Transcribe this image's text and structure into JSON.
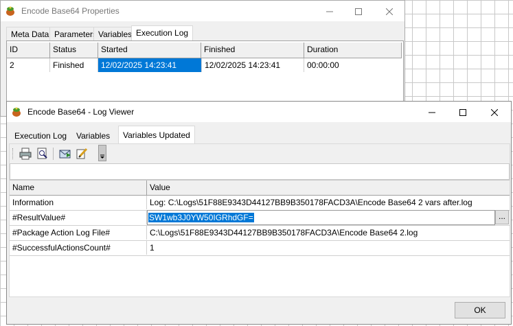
{
  "props_window": {
    "title": "Encode Base64 Properties",
    "tabs": [
      "Meta Data",
      "Parameters",
      "Variables",
      "Execution Log"
    ],
    "columns": [
      "ID",
      "Status",
      "Started",
      "Finished",
      "Duration"
    ],
    "rows": [
      {
        "id": "2",
        "status": "Finished",
        "started": "12/02/2025 14:23:41",
        "finished": "12/02/2025 14:23:41",
        "duration": "00:00:00"
      }
    ]
  },
  "log_window": {
    "title": "Encode Base64 - Log Viewer",
    "tabs": [
      "Execution Log",
      "Variables",
      "Variables Updated"
    ],
    "columns": [
      "Name",
      "Value"
    ],
    "rows": [
      {
        "name": "Information",
        "value": "Log: C:\\Logs\\51F88E9343D44127BB9B350178FACD3A\\Encode Base64 2 vars after.log"
      },
      {
        "name": "#ResultValue#",
        "value": "SW1wb3J0YW50IGRhdGF="
      },
      {
        "name": "#Package Action Log File#",
        "value": "C:\\Logs\\51F88E9343D44127BB9B350178FACD3A\\Encode Base64 2.log"
      },
      {
        "name": "#SuccessfulActionsCount#",
        "value": "1"
      }
    ],
    "ellipsis_label": "...",
    "ok_label": "OK"
  },
  "colors": {
    "selection": "#0078d7"
  }
}
